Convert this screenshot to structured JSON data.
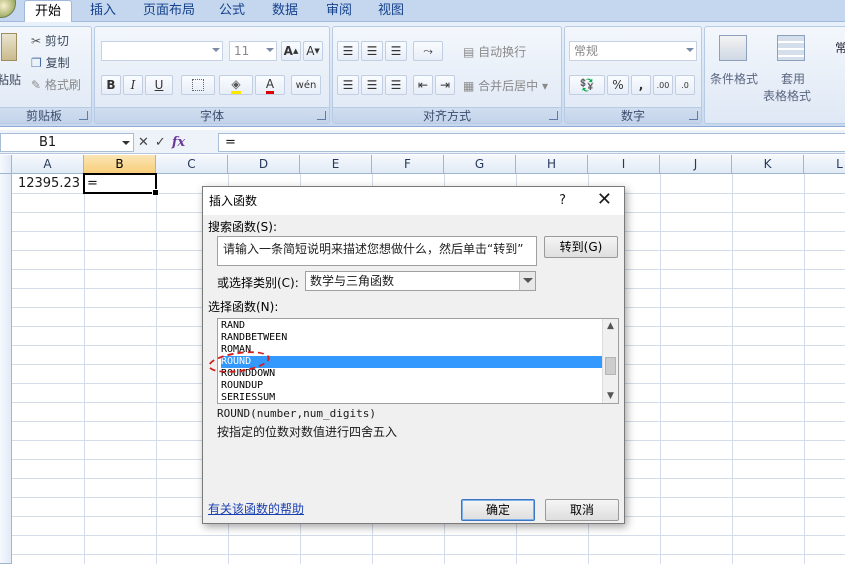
{
  "tabs": [
    {
      "label": "开始",
      "active": true
    },
    {
      "label": "插入"
    },
    {
      "label": "页面布局"
    },
    {
      "label": "公式"
    },
    {
      "label": "数据"
    },
    {
      "label": "审阅"
    },
    {
      "label": "视图"
    }
  ],
  "ribbon": {
    "clipboard": {
      "label": "剪贴板",
      "paste": "粘贴",
      "cut": "剪切",
      "copy": "复制",
      "format_painter": "格式刷"
    },
    "font": {
      "label": "字体",
      "font_size": "11",
      "bold": "B",
      "italic": "I",
      "underline": "U"
    },
    "alignment": {
      "label": "对齐方式",
      "wrap_text": "自动换行",
      "merge_center": "合并后居中"
    },
    "number": {
      "label": "数字",
      "format": "常规",
      "percent": "%",
      "comma": ","
    },
    "styles": {
      "conditional_format": "条件格式",
      "table_format_1": "套用",
      "table_format_2": "表格格式",
      "cell_styles": "常"
    }
  },
  "formula_bar": {
    "name_box": "B1",
    "fx": "fx",
    "formula": "="
  },
  "grid": {
    "columns": [
      "A",
      "B",
      "C",
      "D",
      "E",
      "F",
      "G",
      "H",
      "I",
      "J",
      "K",
      "L"
    ],
    "selected_column": "B",
    "cells": {
      "A1": "12395.23",
      "B1": "="
    }
  },
  "dialog": {
    "title": "插入函数",
    "help": "?",
    "close": "✕",
    "search_label": "搜索函数(S):",
    "search_value": "请输入一条简短说明来描述您想做什么，然后单击“转到”",
    "go_button": "转到(G)",
    "category_label": "或选择类别(C):",
    "category_value": "数学与三角函数",
    "function_label": "选择函数(N):",
    "functions": [
      "RAND",
      "RANDBETWEEN",
      "ROMAN",
      "ROUND",
      "ROUNDDOWN",
      "ROUNDUP",
      "SERIESSUM"
    ],
    "selected_function": "ROUND",
    "syntax": "ROUND(number,num_digits)",
    "description": "按指定的位数对数值进行四舍五入",
    "help_link": "有关该函数的帮助",
    "ok_button": "确定",
    "cancel_button": "取消"
  }
}
